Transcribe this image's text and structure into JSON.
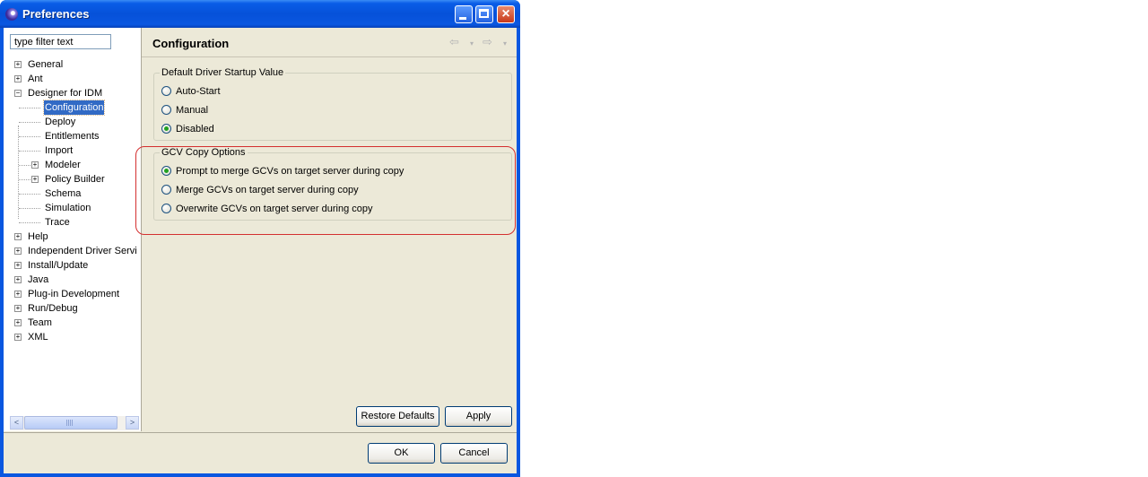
{
  "window": {
    "title": "Preferences"
  },
  "filter": {
    "placeholder": "type filter text"
  },
  "tree": {
    "items": [
      {
        "label": "General",
        "expander": "+"
      },
      {
        "label": "Ant",
        "expander": "+"
      },
      {
        "label": "Designer for IDM",
        "expander": "−"
      },
      {
        "label": "Configuration",
        "selected": true
      },
      {
        "label": "Deploy"
      },
      {
        "label": "Entitlements"
      },
      {
        "label": "Import"
      },
      {
        "label": "Modeler",
        "expander": "+"
      },
      {
        "label": "Policy Builder",
        "expander": "+"
      },
      {
        "label": "Schema"
      },
      {
        "label": "Simulation"
      },
      {
        "label": "Trace"
      },
      {
        "label": "Help",
        "expander": "+"
      },
      {
        "label": "Independent Driver Servi",
        "expander": "+"
      },
      {
        "label": "Install/Update",
        "expander": "+"
      },
      {
        "label": "Java",
        "expander": "+"
      },
      {
        "label": "Plug-in Development",
        "expander": "+"
      },
      {
        "label": "Run/Debug",
        "expander": "+"
      },
      {
        "label": "Team",
        "expander": "+"
      },
      {
        "label": "XML",
        "expander": "+"
      }
    ]
  },
  "page": {
    "title": "Configuration",
    "nav": {
      "back": "⇦",
      "forward": "⇨",
      "dropdown": "▾"
    }
  },
  "driver_group": {
    "legend": "Default Driver Startup Value",
    "options": [
      {
        "label": "Auto-Start",
        "checked": false
      },
      {
        "label": "Manual",
        "checked": false
      },
      {
        "label": "Disabled",
        "checked": true
      }
    ]
  },
  "gcv_group": {
    "legend": "GCV Copy Options",
    "options": [
      {
        "label": "Prompt to merge GCVs on target server during copy",
        "checked": true
      },
      {
        "label": "Merge GCVs on target server during copy",
        "checked": false
      },
      {
        "label": "Overwrite GCVs on target server during copy",
        "checked": false
      }
    ]
  },
  "buttons": {
    "restore_defaults": "Restore Defaults",
    "apply": "Apply",
    "ok": "OK",
    "cancel": "Cancel"
  },
  "scroll": {
    "left": "<",
    "right": ">"
  },
  "titlebar_buttons": {
    "close": "×"
  },
  "colors": {
    "selection": "#316ac5",
    "annotation": "#d43030",
    "titlebar": "#0a57e0"
  }
}
